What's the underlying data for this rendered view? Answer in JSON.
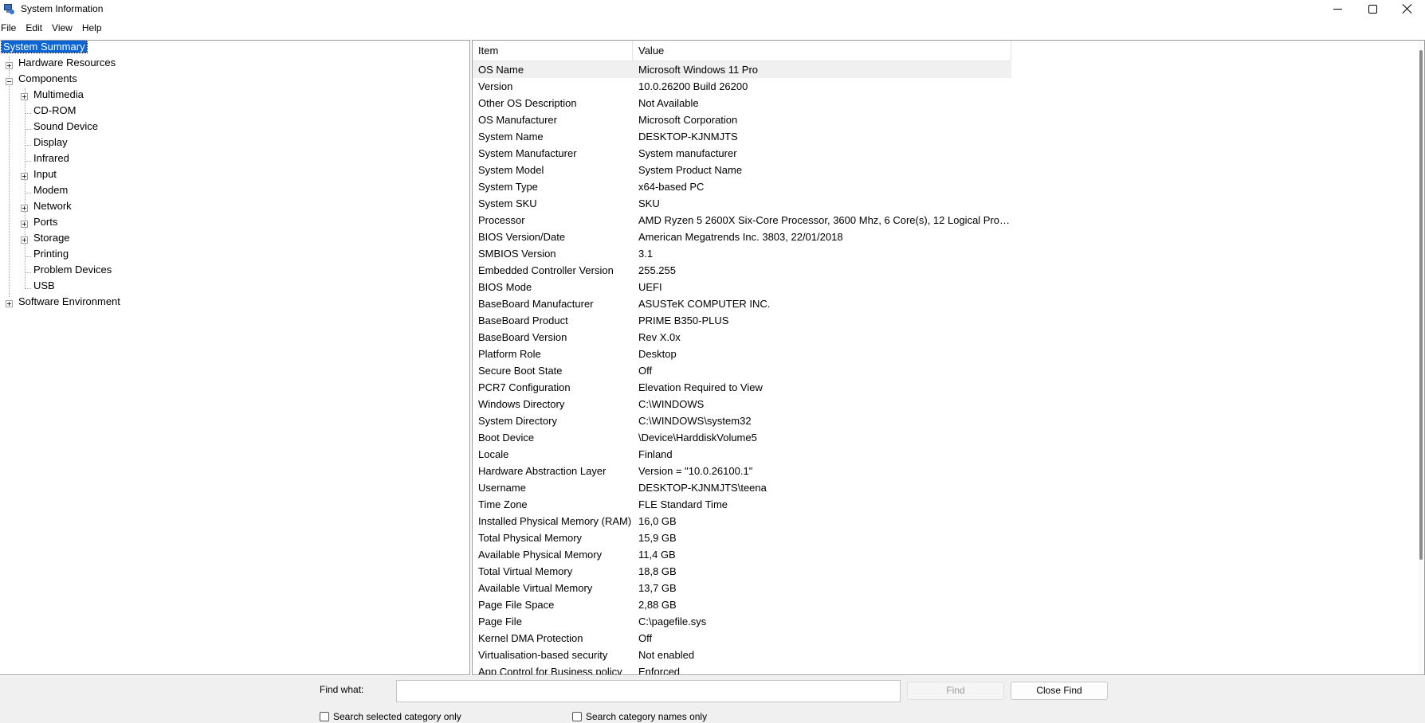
{
  "window": {
    "title": "System Information",
    "icon": "system-info-icon"
  },
  "menu": [
    "File",
    "Edit",
    "View",
    "Help"
  ],
  "tree": {
    "nodes": [
      {
        "label": "System Summary",
        "selected": true
      },
      {
        "label": "Hardware Resources",
        "expander": "plus"
      },
      {
        "label": "Components",
        "expander": "minus"
      },
      {
        "label": "Multimedia",
        "expander": "plus"
      },
      {
        "label": "CD-ROM"
      },
      {
        "label": "Sound Device"
      },
      {
        "label": "Display"
      },
      {
        "label": "Infrared"
      },
      {
        "label": "Input",
        "expander": "plus"
      },
      {
        "label": "Modem"
      },
      {
        "label": "Network",
        "expander": "plus"
      },
      {
        "label": "Ports",
        "expander": "plus"
      },
      {
        "label": "Storage",
        "expander": "plus"
      },
      {
        "label": "Printing"
      },
      {
        "label": "Problem Devices"
      },
      {
        "label": "USB"
      },
      {
        "label": "Software Environment",
        "expander": "plus"
      }
    ]
  },
  "list": {
    "columns": {
      "item": "Item",
      "value": "Value"
    },
    "rows": [
      {
        "item": "OS Name",
        "value": "Microsoft Windows 11 Pro"
      },
      {
        "item": "Version",
        "value": "10.0.26200 Build 26200"
      },
      {
        "item": "Other OS Description",
        "value": "Not Available"
      },
      {
        "item": "OS Manufacturer",
        "value": "Microsoft Corporation"
      },
      {
        "item": "System Name",
        "value": "DESKTOP-KJNMJTS"
      },
      {
        "item": "System Manufacturer",
        "value": "System manufacturer"
      },
      {
        "item": "System Model",
        "value": "System Product Name"
      },
      {
        "item": "System Type",
        "value": "x64-based PC"
      },
      {
        "item": "System SKU",
        "value": "SKU"
      },
      {
        "item": "Processor",
        "value": "AMD Ryzen 5 2600X Six-Core Processor, 3600 Mhz, 6 Core(s), 12 Logical Proc..."
      },
      {
        "item": "BIOS Version/Date",
        "value": "American Megatrends Inc. 3803, 22/01/2018"
      },
      {
        "item": "SMBIOS Version",
        "value": "3.1"
      },
      {
        "item": "Embedded Controller Version",
        "value": "255.255"
      },
      {
        "item": "BIOS Mode",
        "value": "UEFI"
      },
      {
        "item": "BaseBoard Manufacturer",
        "value": "ASUSTeK COMPUTER INC."
      },
      {
        "item": "BaseBoard Product",
        "value": "PRIME B350-PLUS"
      },
      {
        "item": "BaseBoard Version",
        "value": "Rev X.0x"
      },
      {
        "item": "Platform Role",
        "value": "Desktop"
      },
      {
        "item": "Secure Boot State",
        "value": "Off"
      },
      {
        "item": "PCR7 Configuration",
        "value": "Elevation Required to View"
      },
      {
        "item": "Windows Directory",
        "value": "C:\\WINDOWS"
      },
      {
        "item": "System Directory",
        "value": "C:\\WINDOWS\\system32"
      },
      {
        "item": "Boot Device",
        "value": "\\Device\\HarddiskVolume5"
      },
      {
        "item": "Locale",
        "value": "Finland"
      },
      {
        "item": "Hardware Abstraction Layer",
        "value": "Version = \"10.0.26100.1\""
      },
      {
        "item": "Username",
        "value": "DESKTOP-KJNMJTS\\teena"
      },
      {
        "item": "Time Zone",
        "value": "FLE Standard Time"
      },
      {
        "item": "Installed Physical Memory (RAM)",
        "value": "16,0 GB"
      },
      {
        "item": "Total Physical Memory",
        "value": "15,9 GB"
      },
      {
        "item": "Available Physical Memory",
        "value": "11,4 GB"
      },
      {
        "item": "Total Virtual Memory",
        "value": "18,8 GB"
      },
      {
        "item": "Available Virtual Memory",
        "value": "13,7 GB"
      },
      {
        "item": "Page File Space",
        "value": "2,88 GB"
      },
      {
        "item": "Page File",
        "value": "C:\\pagefile.sys"
      },
      {
        "item": "Kernel DMA Protection",
        "value": "Off"
      },
      {
        "item": "Virtualisation-based security",
        "value": "Not enabled"
      },
      {
        "item": "App Control for Business policy",
        "value": "Enforced"
      }
    ]
  },
  "find": {
    "label": "Find what:",
    "value": "",
    "find_button": "Find",
    "close_button": "Close Find",
    "search_selected_label": "Search selected category only",
    "search_names_label": "Search category names only"
  }
}
